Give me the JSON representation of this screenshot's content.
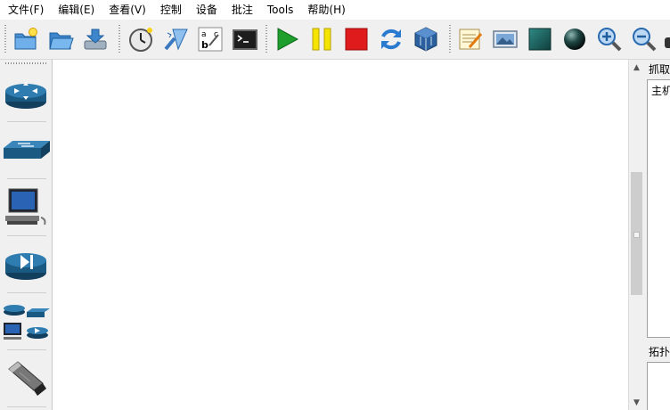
{
  "menubar": {
    "items": [
      "文件(F)",
      "编辑(E)",
      "查看(V)",
      "控制",
      "设备",
      "批注",
      "Tools",
      "帮助(H)"
    ]
  },
  "toolbar": {
    "buttons": [
      "new-file-icon",
      "open-folder-icon",
      "save-icon",
      "timer-icon",
      "wizard-icon",
      "abc-text-icon",
      "terminal-icon",
      "play-icon",
      "pause-icon",
      "stop-icon",
      "refresh-icon",
      "virtualbox-icon",
      "notepad-icon",
      "image-icon",
      "cube-icon",
      "sphere-icon",
      "zoom-in-icon",
      "zoom-out-icon"
    ]
  },
  "sidebar": {
    "devices": [
      "router-icon",
      "switch-icon",
      "computer-icon",
      "media-player-icon",
      "network-group-icon",
      "usb-device-icon"
    ]
  },
  "rightpanel": {
    "capture_title": "抓取",
    "capture_item": "主机",
    "topology_title": "拓扑"
  },
  "colors": {
    "accent_blue": "#1f6aa5",
    "play_green": "#1e9e2d",
    "pause_yellow": "#f4e400",
    "stop_red": "#e01b1b"
  }
}
